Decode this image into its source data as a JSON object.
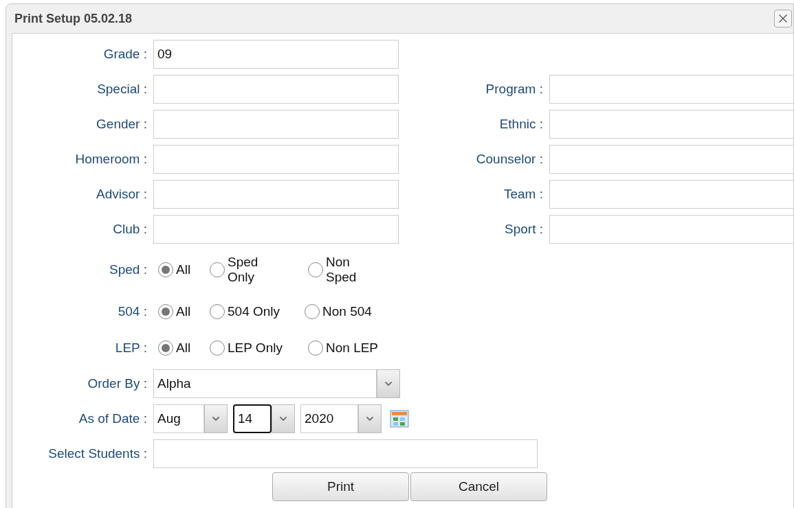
{
  "window": {
    "title": "Print Setup 05.02.18"
  },
  "rows": [
    {
      "left": {
        "label": "Grade :",
        "value": "09"
      }
    },
    {
      "left": {
        "label": "Special :"
      },
      "right": {
        "label": "Program :"
      }
    },
    {
      "left": {
        "label": "Gender :"
      },
      "right": {
        "label": "Ethnic :"
      }
    },
    {
      "left": {
        "label": "Homeroom :"
      },
      "right": {
        "label": "Counselor :"
      }
    },
    {
      "left": {
        "label": "Advisor :"
      },
      "right": {
        "label": "Team :"
      }
    },
    {
      "left": {
        "label": "Club :"
      },
      "right": {
        "label": "Sport :"
      }
    }
  ],
  "radio_groups": [
    {
      "label": "Sped :",
      "options": [
        {
          "label": "All",
          "selected": true
        },
        {
          "label": "Sped Only",
          "selected": false
        },
        {
          "label": "Non Sped",
          "selected": false
        }
      ]
    },
    {
      "label": "504 :",
      "options": [
        {
          "label": "All",
          "selected": true
        },
        {
          "label": "504 Only",
          "selected": false
        },
        {
          "label": "Non 504",
          "selected": false
        }
      ]
    },
    {
      "label": "LEP :",
      "options": [
        {
          "label": "All",
          "selected": true
        },
        {
          "label": "LEP Only",
          "selected": false
        },
        {
          "label": "Non LEP",
          "selected": false
        }
      ]
    }
  ],
  "order_by": {
    "label": "Order By :",
    "value": "Alpha"
  },
  "as_of_date": {
    "label": "As of Date :",
    "parts": [
      {
        "value": "Aug",
        "focused": false
      },
      {
        "value": "14",
        "focused": true
      },
      {
        "value": "2020",
        "focused": false
      }
    ]
  },
  "select_students": {
    "label": "Select Students :"
  },
  "buttons": [
    "Print",
    "Cancel"
  ]
}
